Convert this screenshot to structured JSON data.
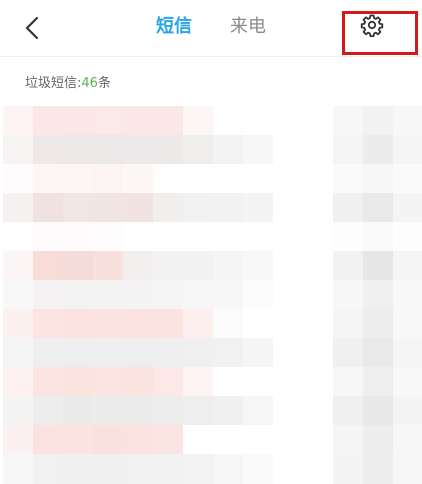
{
  "header": {
    "back_icon": "chevron-left-icon",
    "tabs": [
      {
        "label": "短信",
        "active": true
      },
      {
        "label": "来电",
        "active": false
      }
    ],
    "settings_icon": "gear-icon",
    "accent_color": "#2aa5ea",
    "highlight_color": "#d11b1b"
  },
  "summary": {
    "prefix": "垃圾短信:",
    "count": "46",
    "suffix": "条"
  },
  "messages": {
    "pixelated": true
  }
}
